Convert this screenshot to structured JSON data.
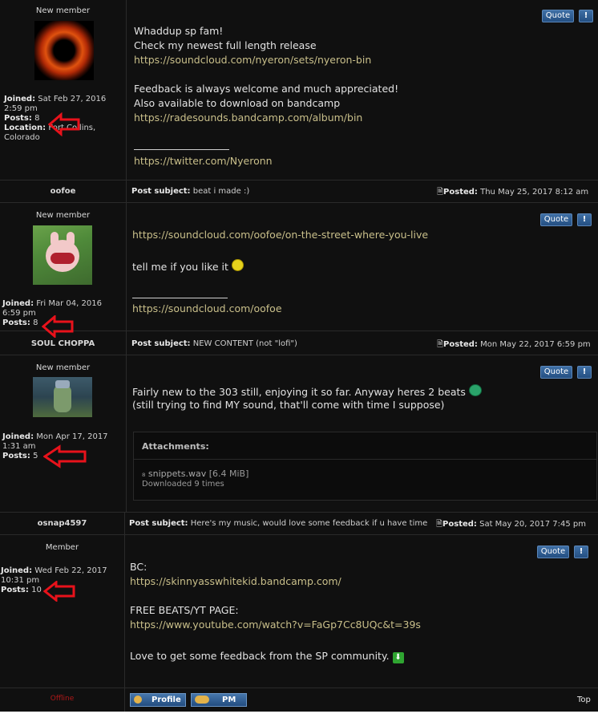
{
  "posts": [
    {
      "rank": "New member",
      "joined_label": "Joined:",
      "joined_value": "Sat Feb 27, 2016",
      "joined_time": "2:59 pm",
      "posts_label": "Posts:",
      "posts_value": "8",
      "location_label": "Location:",
      "location_value_1": "Fort Collins,",
      "location_value_2": "Colorado",
      "quote": "Quote",
      "report": "!",
      "lines": [
        "Whaddup sp fam!",
        "Check my newest full length release"
      ],
      "link1": "https://soundcloud.com/nyeron/sets/nyeron-bin",
      "lines2": [
        "Feedback is always welcome and much appreciated!",
        "Also available to download on bandcamp"
      ],
      "link2": "https://radesounds.bandcamp.com/album/bin",
      "sig_link": "https://twitter.com/Nyeronn"
    },
    {
      "username": "oofoe",
      "subject_label": "Post subject:",
      "subject": "beat i made :)",
      "posted_label": "Posted:",
      "posted": "Thu May 25, 2017 8:12 am",
      "rank": "New member",
      "joined_label": "Joined:",
      "joined_value": "Fri Mar 04, 2016",
      "joined_time": "6:59 pm",
      "posts_label": "Posts:",
      "posts_value": "8",
      "quote": "Quote",
      "report": "!",
      "link1": "https://soundcloud.com/oofoe/on-the-street-where-you-live",
      "text1": "tell me if you like it",
      "sig_link": "https://soundcloud.com/oofoe"
    },
    {
      "username": "SOUL CHOPPA",
      "subject_label": "Post subject:",
      "subject": "NEW CONTENT (not \"lofi\")",
      "posted_label": "Posted:",
      "posted": "Mon May 22, 2017 6:59 pm",
      "rank": "New member",
      "joined_label": "Joined:",
      "joined_value": "Mon Apr 17, 2017",
      "joined_time": "1:31 am",
      "posts_label": "Posts:",
      "posts_value": "5",
      "quote": "Quote",
      "report": "!",
      "text1": "Fairly new to the 303 still, enjoying it so far. Anyway heres 2 beats",
      "text2": "(still trying to find MY sound, that'll come with time I suppose)",
      "attachments_label": "Attachments:",
      "file_name": "snippets.wav",
      "file_size": "[6.4 MiB]",
      "downloads": "Downloaded 9 times"
    },
    {
      "username": "osnap4597",
      "subject_label": "Post subject:",
      "subject": "Here's my music, would love some feedback if u have time",
      "posted_label": "Posted:",
      "posted": "Sat May 20, 2017 7:45 pm",
      "rank": "Member",
      "joined_label": "Joined:",
      "joined_value": "Wed Feb 22, 2017",
      "joined_time": "10:31 pm",
      "posts_label": "Posts:",
      "posts_value": "10",
      "quote": "Quote",
      "report": "!",
      "bc_label": "BC:",
      "bc_link": "https://skinnyasswhitekid.bandcamp.com/",
      "free_label": "FREE BEATS/YT PAGE:",
      "yt_link": "https://www.youtube.com/watch?v=FaGp7Cc8UQc&t=39s",
      "closing": "Love to get some feedback from the SP community.",
      "status": "Offline",
      "profile_btn": "Profile",
      "pm_btn": "PM",
      "top_link": "Top"
    }
  ],
  "colors": {
    "arrow": "#e8121b",
    "offline": "#b01818",
    "quote_btn": "#2f5f96"
  }
}
